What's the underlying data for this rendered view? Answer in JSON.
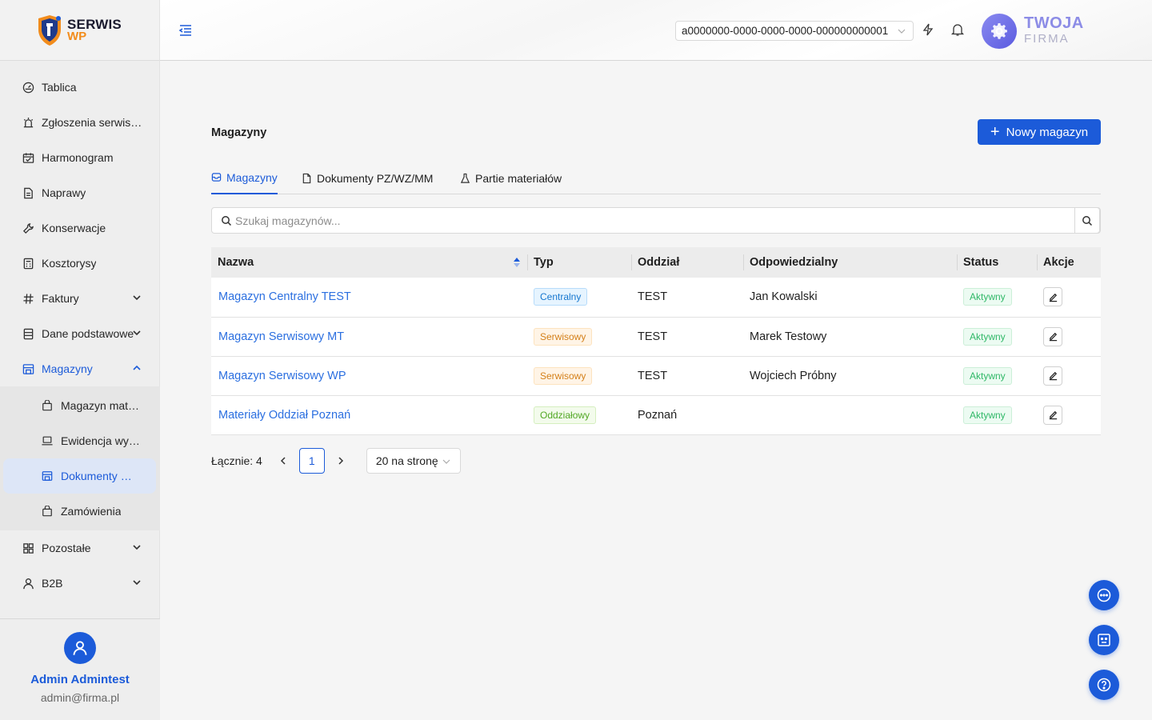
{
  "brand": {
    "line1": "SERWIS",
    "line2": "WP"
  },
  "sidebar": {
    "items": [
      {
        "key": "tablica",
        "label": "Tablica",
        "icon": "dashboard-icon"
      },
      {
        "key": "zgloszenia",
        "label": "Zgłoszenia serwisowe",
        "icon": "alarm-icon"
      },
      {
        "key": "harmonogram",
        "label": "Harmonogram",
        "icon": "calendar-icon"
      },
      {
        "key": "naprawy",
        "label": "Naprawy",
        "icon": "document-icon"
      },
      {
        "key": "konserwacje",
        "label": "Konserwacje",
        "icon": "wrench-icon"
      },
      {
        "key": "kosztorysy",
        "label": "Kosztorysy",
        "icon": "calculator-icon"
      },
      {
        "key": "faktury",
        "label": "Faktury",
        "icon": "hash-icon"
      },
      {
        "key": "dane",
        "label": "Dane podstawowe",
        "icon": "database-icon"
      },
      {
        "key": "magazyny",
        "label": "Magazyny",
        "icon": "warehouse-icon"
      }
    ],
    "submenu": [
      {
        "key": "magazyn-materialow",
        "label": "Magazyn materiałów",
        "icon": "box-icon"
      },
      {
        "key": "ewidencja",
        "label": "Ewidencja wyposażenia",
        "icon": "laptop-icon"
      },
      {
        "key": "dokumenty",
        "label": "Dokumenty magazynowe",
        "icon": "warehouse-icon"
      },
      {
        "key": "zamowienia",
        "label": "Zamówienia",
        "icon": "bag-icon"
      }
    ],
    "bottom_items": [
      {
        "key": "pozostale",
        "label": "Pozostałe",
        "icon": "grid-icon"
      },
      {
        "key": "b2b",
        "label": "B2B",
        "icon": "user-icon"
      }
    ]
  },
  "user": {
    "name": "Admin Admintest",
    "email": "admin@firma.pl"
  },
  "header": {
    "tenant_id": "a0000000-0000-0000-0000-000000000001",
    "company_line1": "TWOJA",
    "company_line2": "FIRMA"
  },
  "page": {
    "title": "Magazyny",
    "new_button": "Nowy magazyn",
    "tabs": [
      {
        "label": "Magazyny",
        "icon": "inbox-icon",
        "active": true
      },
      {
        "label": "Dokumenty PZ/WZ/MM",
        "icon": "file-icon",
        "active": false
      },
      {
        "label": "Partie materiałów",
        "icon": "flask-icon",
        "active": false
      }
    ],
    "search_placeholder": "Szukaj magazynów..."
  },
  "table": {
    "columns": [
      "Nazwa",
      "Typ",
      "Oddział",
      "Odpowiedzialny",
      "Status",
      "Akcje"
    ],
    "rows": [
      {
        "name": "Magazyn Centralny TEST",
        "type": "Centralny",
        "type_color": "blue",
        "branch": "TEST",
        "responsible": "Jan Kowalski",
        "status": "Aktywny"
      },
      {
        "name": "Magazyn Serwisowy MT",
        "type": "Serwisowy",
        "type_color": "orange",
        "branch": "TEST",
        "responsible": "Marek Testowy",
        "status": "Aktywny"
      },
      {
        "name": "Magazyn Serwisowy WP",
        "type": "Serwisowy",
        "type_color": "orange",
        "branch": "TEST",
        "responsible": "Wojciech Próbny",
        "status": "Aktywny"
      },
      {
        "name": "Materiały Oddział Poznań",
        "type": "Oddziałowy",
        "type_color": "green",
        "branch": "Poznań",
        "responsible": "",
        "status": "Aktywny"
      }
    ]
  },
  "pagination": {
    "total": "Łącznie: 4",
    "current_page": "1",
    "page_size": "20 na stronę"
  },
  "colors": {
    "primary": "#1c5bd9",
    "link": "#2b6fe0",
    "brand_orange": "#f28c1c"
  }
}
